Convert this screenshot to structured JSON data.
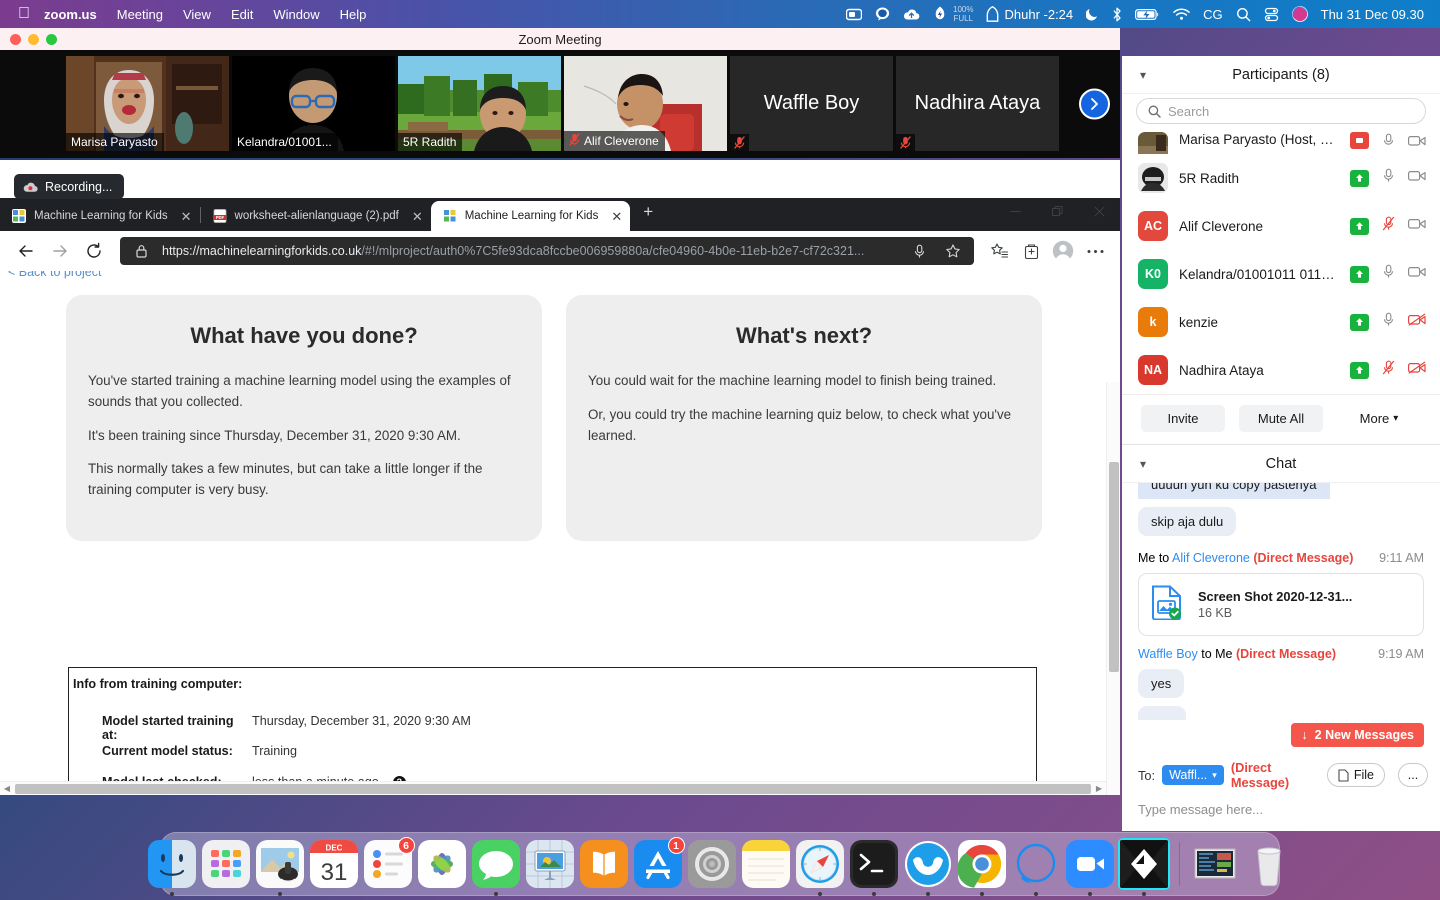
{
  "menubar": {
    "apple": "apple-logo",
    "items": [
      {
        "label": "zoom.us",
        "bold": true
      },
      {
        "label": "Meeting",
        "bold": false
      },
      {
        "label": "View",
        "bold": false
      },
      {
        "label": "Edit",
        "bold": false
      },
      {
        "label": "Window",
        "bold": false
      },
      {
        "label": "Help",
        "bold": false
      }
    ],
    "status": {
      "battery_pct": "100%",
      "battery_state": "FULL",
      "prayer_label": "Dhuhr -2:24",
      "input_source": "CG",
      "clock": "Thu 31 Dec  09.30"
    }
  },
  "zoom_window": {
    "title": "Zoom Meeting",
    "next_page_icon": "chevron-right-icon",
    "tiles": [
      {
        "name": "Marisa Paryasto",
        "video": true,
        "active": true,
        "muted": false
      },
      {
        "name": "Kelandra/01001...",
        "video": true,
        "active": false,
        "muted": false
      },
      {
        "name": "5R Radith",
        "video": true,
        "active": false,
        "muted": false
      },
      {
        "name": "Alif Cleverone",
        "video": true,
        "active": false,
        "muted": true
      },
      {
        "name": "Waffle Boy",
        "video": false,
        "active": false,
        "muted": true
      },
      {
        "name": "Nadhira Ataya",
        "video": false,
        "active": false,
        "muted": true
      }
    ]
  },
  "browser": {
    "recording_label": "Recording...",
    "tabs": [
      {
        "title": "Machine Learning for Kids",
        "active": false,
        "favicon": "ml4k-icon"
      },
      {
        "title": "worksheet-alienlanguage (2).pdf",
        "active": false,
        "favicon": "pdf-icon"
      },
      {
        "title": "Machine Learning for Kids",
        "active": true,
        "favicon": "ml4k-icon"
      }
    ],
    "new_tab_label": "+",
    "window_controls": {
      "minimize": "minimize-icon",
      "maximize": "maximize-icon",
      "close": "close-icon"
    },
    "url_domain": "https://machinelearningforkids.co.uk",
    "url_path": "/#!/mlproject/auth0%7C5fe93dca8fccbe006959880a/cfe04960-4b0e-11eb-b2e7-cf72c321...",
    "nav": {
      "back": "back-arrow-icon",
      "forward": "forward-arrow-icon",
      "reload": "reload-icon",
      "lock": "lock-icon",
      "mic": "microphone-icon",
      "star": "star-icon",
      "favorites": "favorites-icon",
      "collections": "collections-icon",
      "profile": "profile-icon",
      "settings": "more-options-icon"
    }
  },
  "page": {
    "back_link": "< Back to project",
    "cards": [
      {
        "title": "What have you done?",
        "paragraphs": [
          "You've started training a machine learning model using the examples of sounds that you collected.",
          "It's been training since Thursday, December 31, 2020 9:30 AM.",
          "This normally takes a few minutes, but can take a little longer if the training computer is very busy."
        ]
      },
      {
        "title": "What's next?",
        "paragraphs": [
          "You could wait for the machine learning model to finish being trained.",
          "Or, you could try the machine learning quiz below, to check what you've learned."
        ]
      }
    ],
    "info_box": {
      "title": "Info from training computer:",
      "rows": [
        {
          "label": "Model started training at:",
          "value": "Thursday, December 31, 2020 9:30 AM",
          "help": false
        },
        {
          "label": "Current model status:",
          "value": "Training",
          "help": false
        },
        {
          "label": "Model last checked:",
          "value": "less than a minute ago",
          "help": true
        }
      ]
    }
  },
  "participants_panel": {
    "title": "Participants (8)",
    "collapse_icon": "chevron-down-icon",
    "search_placeholder": "Search",
    "search_icon": "search-icon",
    "items": [
      {
        "name": "Marisa Paryasto (Host, me)",
        "initials": "",
        "color": "#8a7a5a",
        "cut": true,
        "mic": "mic-muted-red",
        "video": "video-on",
        "raise": false
      },
      {
        "name": "5R Radith",
        "initials": "",
        "color": "#4f4f4f",
        "cut": false,
        "mic": "mic-on",
        "video": "video-on",
        "raise": true
      },
      {
        "name": "Alif Cleverone",
        "initials": "AC",
        "color": "#e2483b",
        "cut": false,
        "mic": "mic-muted",
        "video": "video-on",
        "raise": true
      },
      {
        "name": "Kelandra/01001011 0110...",
        "initials": "K0",
        "color": "#14b366",
        "cut": false,
        "mic": "mic-on",
        "video": "video-on",
        "raise": true
      },
      {
        "name": "kenzie",
        "initials": "k",
        "color": "#e87b0a",
        "cut": false,
        "mic": "mic-on",
        "video": "video-off",
        "raise": true
      },
      {
        "name": "Nadhira Ataya",
        "initials": "NA",
        "color": "#d8392c",
        "cut": false,
        "mic": "mic-muted",
        "video": "video-off",
        "raise": true
      }
    ],
    "actions": [
      {
        "label": "Invite",
        "style": "filled"
      },
      {
        "label": "Mute All",
        "style": "filled"
      },
      {
        "label": "More",
        "style": "plain",
        "icon": "chevron-down-icon"
      }
    ]
  },
  "chat_panel": {
    "title": "Chat",
    "collapse_icon": "chevron-down-icon",
    "messages": [
      {
        "kind": "bubble",
        "text": "uuuun yun ku copy pastenya",
        "cut": true
      },
      {
        "kind": "bubble",
        "text": "skip aja dulu",
        "cut": false
      },
      {
        "kind": "meta",
        "prefix": "Me to ",
        "who": "Alif Cleverone",
        "dm": "(Direct Message)",
        "time": "9:11 AM"
      },
      {
        "kind": "file",
        "name": "Screen Shot 2020-12-31...",
        "size": "16 KB",
        "icon": "image-file-icon"
      },
      {
        "kind": "meta",
        "prefix": "",
        "who": "Waffle Boy",
        "middle": " to Me ",
        "dm": "(Direct Message)",
        "time": "9:19 AM"
      },
      {
        "kind": "bubble",
        "text": "yes",
        "cut": false
      }
    ],
    "new_messages_label": "2 New Messages",
    "new_messages_icon": "arrow-down-icon",
    "to_label": "To:",
    "to_value": "Waffl...",
    "to_dm": "(Direct Message)",
    "file_button": "File",
    "file_icon": "file-icon",
    "more_button": "...",
    "input_placeholder": "Type message here..."
  },
  "dock": {
    "items": [
      {
        "name": "finder",
        "running": true,
        "badge": null
      },
      {
        "name": "launchpad",
        "running": false,
        "badge": null
      },
      {
        "name": "preview",
        "running": true,
        "badge": null
      },
      {
        "name": "calendar",
        "running": false,
        "badge": null,
        "month": "DEC",
        "day": "31"
      },
      {
        "name": "reminders",
        "running": false,
        "badge": "6"
      },
      {
        "name": "photos",
        "running": false,
        "badge": null
      },
      {
        "name": "messages",
        "running": true,
        "badge": null
      },
      {
        "name": "keynote",
        "running": false,
        "badge": null
      },
      {
        "name": "books",
        "running": false,
        "badge": null
      },
      {
        "name": "app-store",
        "running": false,
        "badge": "1"
      },
      {
        "name": "system-preferences",
        "running": false,
        "badge": null
      },
      {
        "name": "notes",
        "running": false,
        "badge": null
      },
      {
        "name": "safari",
        "running": true,
        "badge": null
      },
      {
        "name": "terminal",
        "running": true,
        "badge": null
      },
      {
        "name": "blue-mask-app",
        "running": true,
        "badge": null
      },
      {
        "name": "chrome",
        "running": true,
        "badge": null
      },
      {
        "name": "blue-circle-app",
        "running": true,
        "badge": null
      },
      {
        "name": "zoom",
        "running": true,
        "badge": null
      },
      {
        "name": "gamemaker",
        "running": true,
        "badge": null,
        "highlighted": true
      }
    ],
    "stack_name": "downloads-stack",
    "trash_name": "trash"
  }
}
